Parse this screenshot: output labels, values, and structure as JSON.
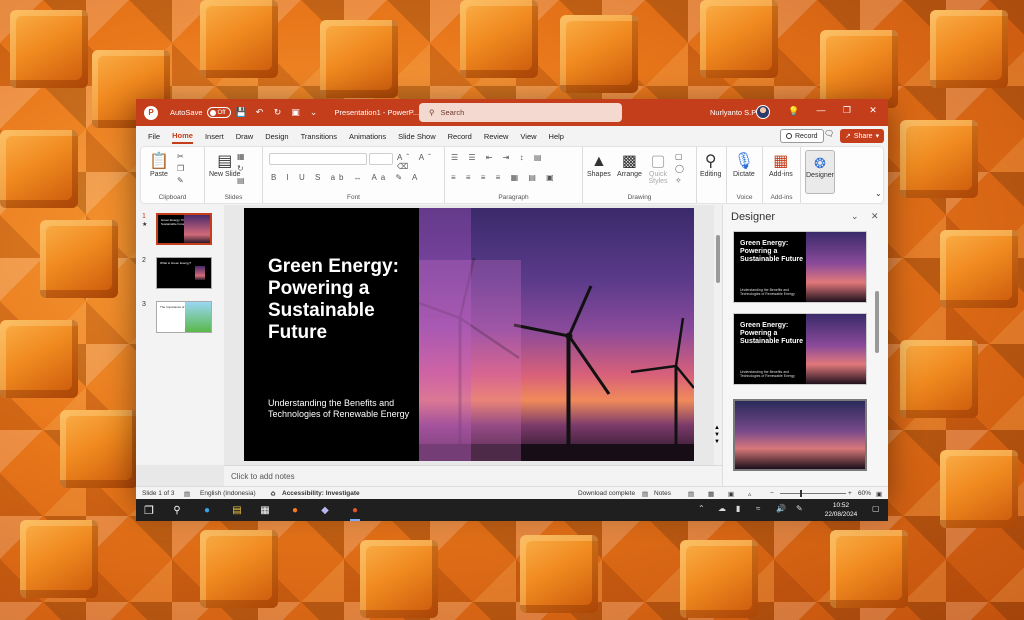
{
  "colors": {
    "accent": "#c43e1c",
    "ribbon_bg": "#fdfdfd",
    "taskbar_bg": "#1f1f1f"
  },
  "titlebar": {
    "app_icon": "powerpoint-icon",
    "autosave_label": "AutoSave",
    "autosave_state": "Off",
    "doc_title": "Presentation1 - PowerP...",
    "search_placeholder": "Search",
    "user_name": "Nurlyanto S.Pd"
  },
  "menu": {
    "tabs": [
      "File",
      "Home",
      "Insert",
      "Draw",
      "Design",
      "Transitions",
      "Animations",
      "Slide Show",
      "Record",
      "Review",
      "View",
      "Help"
    ],
    "active_tab": "Home",
    "record_label": "Record",
    "share_label": "Share"
  },
  "ribbon": {
    "paste_label": "Paste",
    "new_slide_label": "New Slide",
    "groups": {
      "clipboard": "Clipboard",
      "slides": "Slides",
      "font": "Font",
      "paragraph": "Paragraph",
      "drawing": "Drawing",
      "voice": "Voice",
      "addins": "Add-ins"
    },
    "shapes_label": "Shapes",
    "arrange_label": "Arrange",
    "quick_styles_label": "Quick Styles",
    "editing_label": "Editing",
    "dictate_label": "Dictate",
    "addins_label": "Add-ins",
    "designer_label": "Designer"
  },
  "thumbnails": [
    {
      "num": "1",
      "text": "Green Energy: Powering a Sustainable Future"
    },
    {
      "num": "2",
      "text": "What is Green Energy?"
    },
    {
      "num": "3",
      "text": "The Importance of Green Energy"
    }
  ],
  "slide": {
    "title": "Green Energy: Powering a Sustainable Future",
    "subtitle": "Understanding the Benefits and Technologies of Renewable Energy"
  },
  "notes_placeholder": "Click to add notes",
  "designer": {
    "title": "Designer",
    "cards": [
      {
        "title": "Green Energy: Powering a Sustainable Future",
        "subtitle": "Understanding the Benefits and Technologies of Renewable Energy"
      },
      {
        "title": "Green Energy: Powering a Sustainable Future",
        "subtitle": "Understanding the Benefits and Technologies of Renewable Energy"
      }
    ]
  },
  "status": {
    "slide_info": "Slide 1 of 3",
    "language": "English (Indonesia)",
    "accessibility": "Accessibility: Investigate",
    "download": "Download complete",
    "notes": "Notes",
    "zoom": "60%"
  },
  "taskbar": {
    "time": "10:52",
    "date": "22/08/2024",
    "apps": [
      "windows-start-icon",
      "search-icon",
      "edge-icon",
      "file-explorer-icon",
      "store-icon",
      "firefox-icon",
      "app-icon",
      "powerpoint-icon"
    ]
  }
}
